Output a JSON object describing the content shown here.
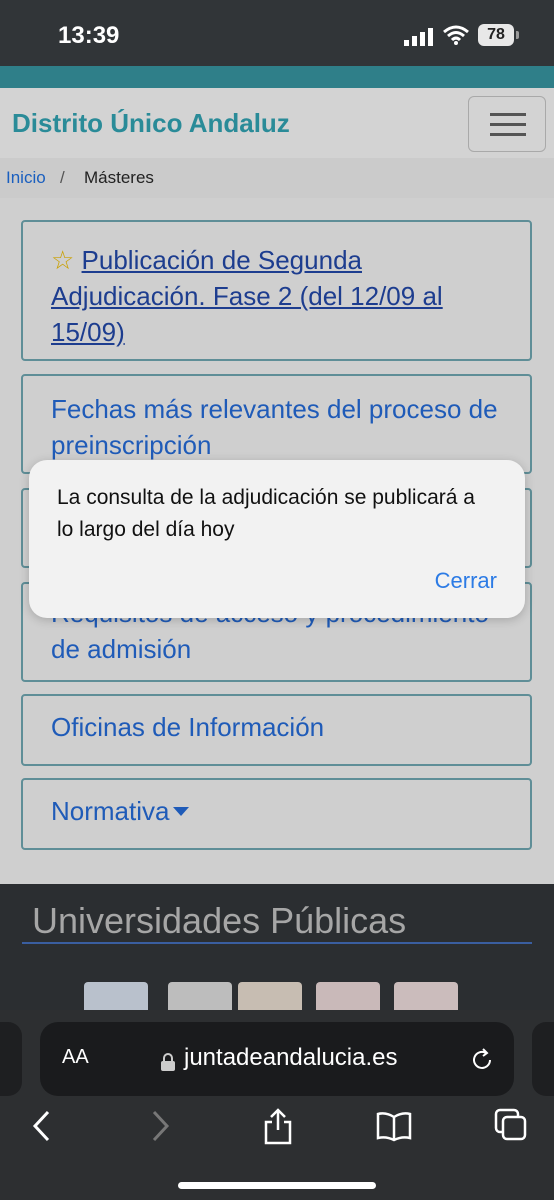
{
  "status": {
    "time": "13:39",
    "battery": "78"
  },
  "navbar": {
    "brand": "Distrito Único Andaluz"
  },
  "breadcrumb": {
    "home": "Inicio",
    "separator": "/",
    "current": "Másteres"
  },
  "cards": [
    {
      "star": "☆",
      "label": "Publicación de Segunda Adjudicación. Fase 2 (del 12/09 al 15/09)"
    },
    {
      "label": "Fechas más relevantes del proceso de preinscripción"
    },
    {
      "label": "Requisitos de acceso y procedimiento de admisión"
    },
    {
      "label": "Oficinas de Información"
    },
    {
      "label": "Normativa"
    }
  ],
  "footer": {
    "title": "Universidades Públicas"
  },
  "dialog": {
    "message": "La consulta de la adjudicación se publicará a lo largo del día hoy",
    "button": "Cerrar"
  },
  "browser": {
    "aa": "AA",
    "url": "juntadeandalucia.es"
  }
}
